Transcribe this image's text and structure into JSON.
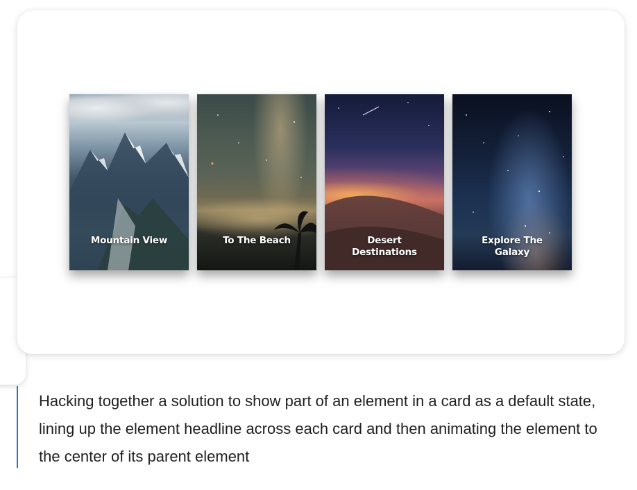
{
  "gallery": {
    "cards": [
      {
        "title": "Mountain View",
        "icon": "mountain-scene"
      },
      {
        "title": "To The Beach",
        "icon": "beach-night-scene"
      },
      {
        "title": "Desert\nDestinations",
        "icon": "desert-sunset-scene"
      },
      {
        "title": "Explore The\nGalaxy",
        "icon": "galaxy-scene"
      }
    ]
  },
  "caption": {
    "text": "Hacking together a solution to show part of an element in a card as a default state, lining up the element headline across each card and then animating the element to the center of its parent element"
  },
  "colors": {
    "accent_border": "#2f6fd1",
    "text": "#1f1f1f"
  }
}
